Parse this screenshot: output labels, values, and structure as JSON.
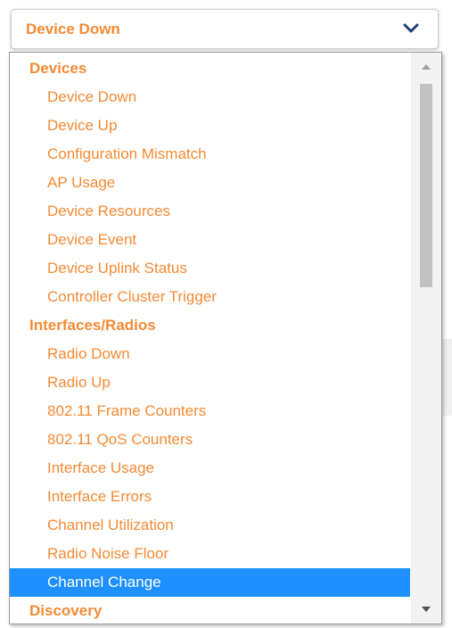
{
  "select": {
    "value": "Device Down"
  },
  "groups": [
    {
      "label": "Devices",
      "items": [
        "Device Down",
        "Device Up",
        "Configuration Mismatch",
        "AP Usage",
        "Device Resources",
        "Device Event",
        "Device Uplink Status",
        "Controller Cluster Trigger"
      ]
    },
    {
      "label": "Interfaces/Radios",
      "items": [
        "Radio Down",
        "Radio Up",
        "802.11 Frame Counters",
        "802.11 QoS Counters",
        "Interface Usage",
        "Interface Errors",
        "Channel Utilization",
        "Radio Noise Floor",
        "Channel Change"
      ]
    },
    {
      "label": "Discovery",
      "items": []
    }
  ],
  "highlighted_item": "Channel Change",
  "colors": {
    "text": "#f58a34",
    "highlight_bg": "#1e90ff",
    "highlight_text": "#ffffff"
  },
  "icons": {
    "dropdown": "chevron-down-icon",
    "scroll_up": "scroll-up-arrow-icon",
    "scroll_down": "scroll-down-arrow-icon"
  }
}
